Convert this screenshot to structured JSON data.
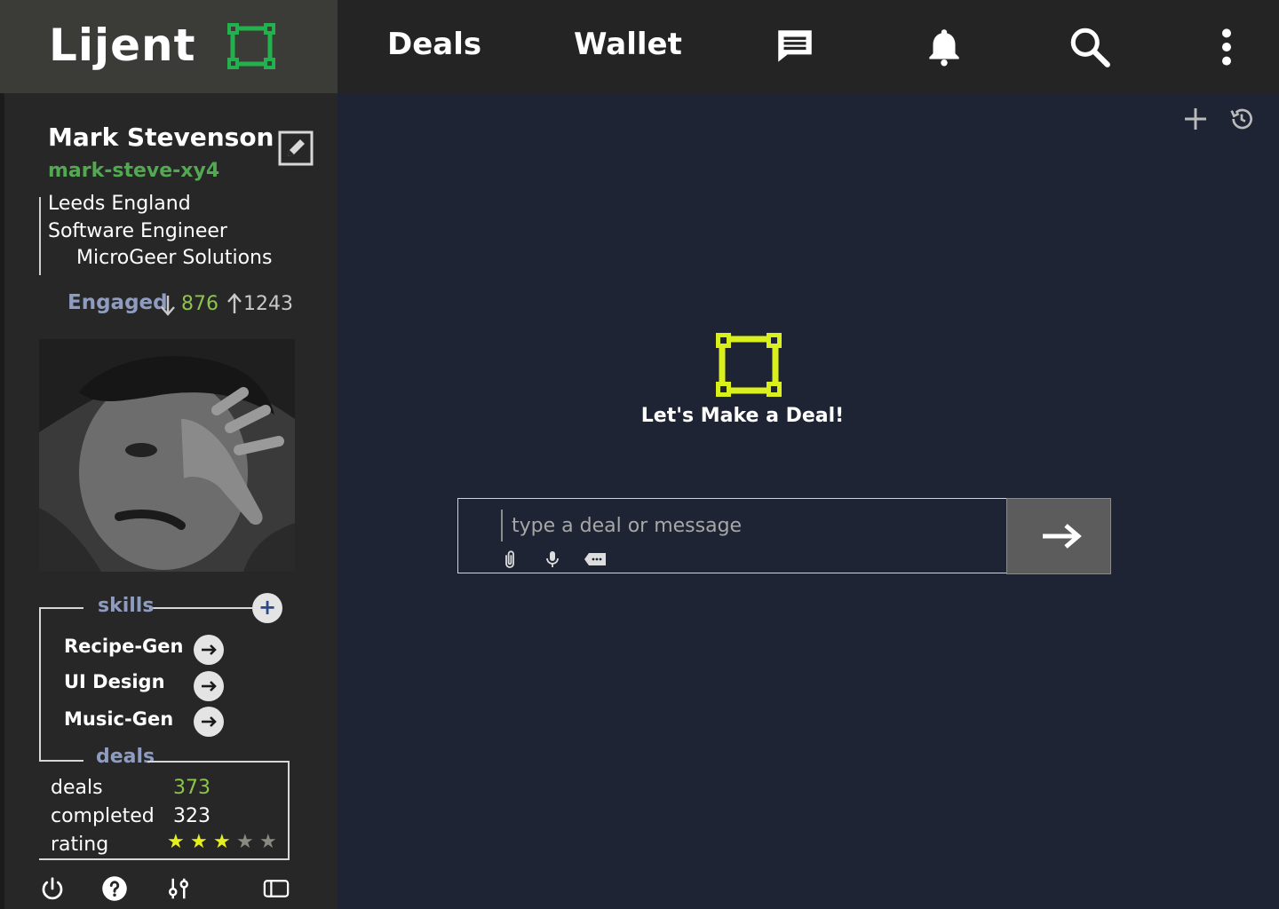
{
  "header": {
    "logo": "Lijent",
    "nav": [
      {
        "label": "Deals"
      },
      {
        "label": "Wallet"
      }
    ],
    "icons": [
      "chat-icon",
      "bell-icon",
      "search-icon",
      "more-vertical-icon"
    ]
  },
  "profile": {
    "name": "Mark Stevenson",
    "handle": "mark-steve-xy4",
    "location": "Leeds England",
    "title": "Software Engineer",
    "company": "MicroGeer Solutions",
    "engaged_label": "Engaged",
    "engaged_in": "876",
    "engaged_out": "1243"
  },
  "skills": {
    "label": "skills",
    "items": [
      {
        "label": "Recipe-Gen"
      },
      {
        "label": "UI Design"
      },
      {
        "label": "Music-Gen"
      }
    ]
  },
  "deals": {
    "label": "deals",
    "rows": [
      {
        "label": "deals",
        "value": "373"
      },
      {
        "label": "completed",
        "value": "323"
      },
      {
        "label": "rating",
        "value": ""
      }
    ],
    "rating": 3,
    "rating_max": 5
  },
  "main": {
    "tagline": "Let's Make a Deal!",
    "composer_placeholder": "type a deal or message"
  },
  "colors": {
    "accent_green": "#22b14c",
    "accent_yellow": "#d9f01c",
    "handle_green": "#53a852",
    "label_blue": "#8e9cc0",
    "star_on": "#e6f020",
    "star_off": "#8a8a80"
  }
}
